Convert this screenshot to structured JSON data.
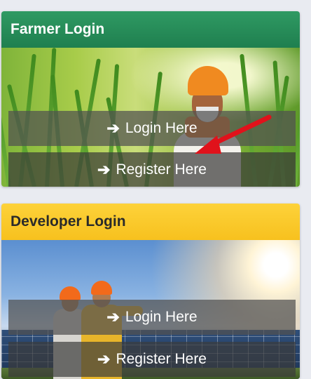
{
  "farmer": {
    "title": "Farmer Login",
    "login_label": "Login Here",
    "register_label": "Register Here",
    "header_color": "#2a8f5a"
  },
  "developer": {
    "title": "Developer Login",
    "login_label": "Login Here",
    "register_label": "Register Here",
    "header_color": "#fcc82b"
  },
  "icons": {
    "arrow": "arrow-right-icon",
    "annotation": "red-arrow-icon"
  },
  "colors": {
    "annotation_arrow": "#e0121b"
  }
}
